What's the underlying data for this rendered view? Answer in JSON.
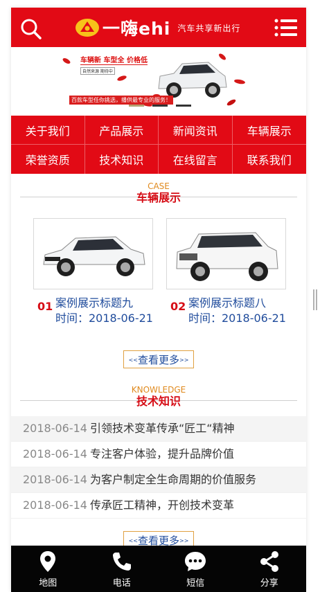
{
  "header": {
    "logo_text": "一嗨ehi",
    "slogan": "汽车共享新出行",
    "search_icon": "search-icon",
    "menu_icon": "menu-icon"
  },
  "banner": {
    "slogan_top": "车辆新 车型全 价格低",
    "sub_note": "自然来源 期待中",
    "slogan_bottom": "百款车型任你挑选，播供最专业的服务！"
  },
  "nav": {
    "items": [
      "关于我们",
      "产品展示",
      "新闻资讯",
      "车辆展示",
      "荣誉资质",
      "技术知识",
      "在线留言",
      "联系我们"
    ]
  },
  "cases": {
    "en": "CASE",
    "zh": "车辆展示",
    "items": [
      {
        "num": "01",
        "title": "案例展示标题九",
        "time": "时间：2018-06-21"
      },
      {
        "num": "02",
        "title": "案例展示标题八",
        "time": "时间：2018-06-21"
      }
    ],
    "more": "查看更多"
  },
  "knowledge": {
    "en": "KNOWLEDGE",
    "zh": "技术知识",
    "items": [
      {
        "date": "2018-06-14",
        "title": "引领技术变革传承“匠工“精神"
      },
      {
        "date": "2018-06-14",
        "title": "专注客户体验，提升品牌价值"
      },
      {
        "date": "2018-06-14",
        "title": "为客户制定全生命周期的价值服务"
      },
      {
        "date": "2018-06-14",
        "title": "传承匠工精神，开创技术变革"
      }
    ],
    "more": "查看更多"
  },
  "bottom_bar": {
    "items": [
      {
        "label": "地图",
        "icon": "map-pin-icon"
      },
      {
        "label": "电话",
        "icon": "phone-icon"
      },
      {
        "label": "短信",
        "icon": "message-icon"
      },
      {
        "label": "分享",
        "icon": "share-icon"
      }
    ]
  },
  "colors": {
    "brand_red": "#e20a15",
    "link_blue": "#204c9c",
    "accent_orange": "#e08a1e"
  }
}
